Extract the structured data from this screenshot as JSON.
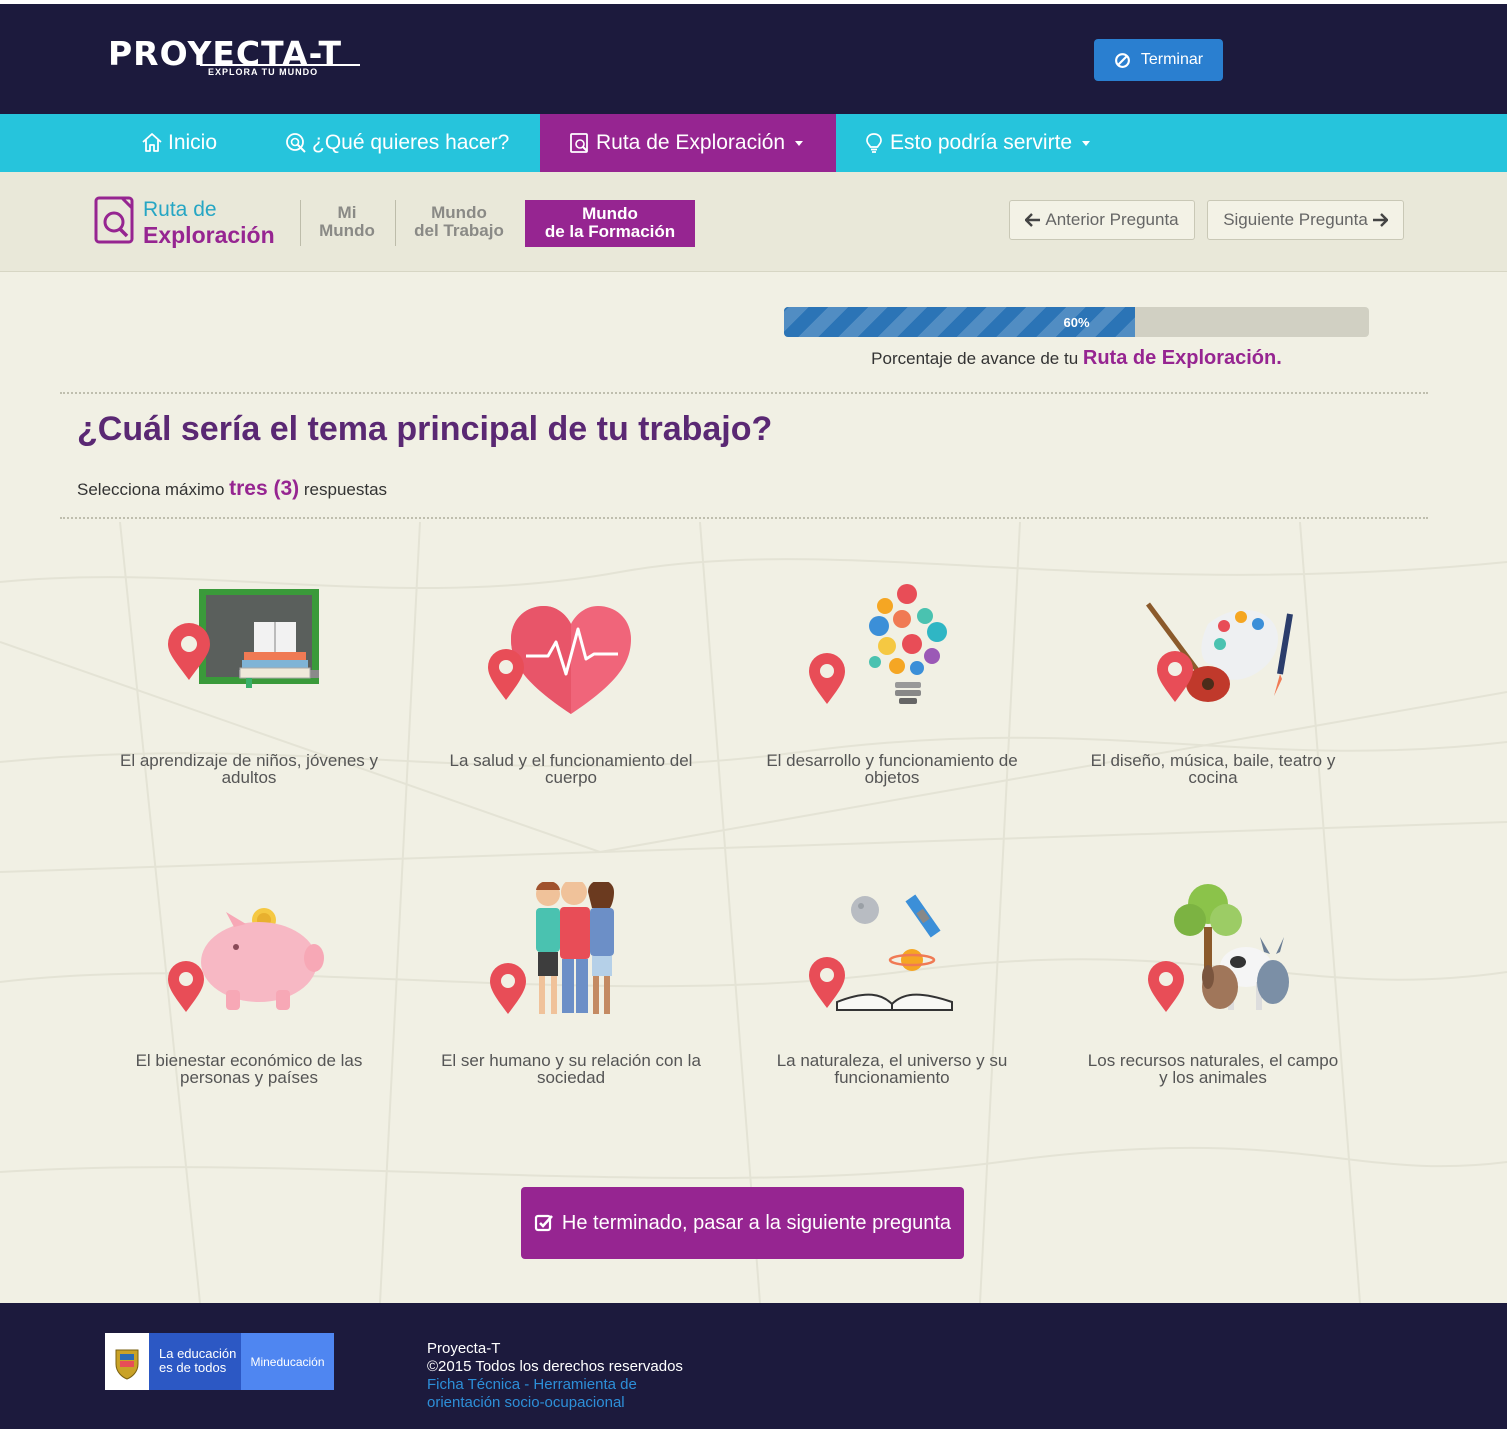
{
  "header": {
    "logo_main": "PROYECTA-T",
    "logo_sub": "EXPLORA TU MUNDO",
    "terminar_label": "Terminar"
  },
  "nav": {
    "items": [
      {
        "label": "Inicio",
        "icon": "home-icon"
      },
      {
        "label": "¿Qué quieres hacer?",
        "icon": "search-icon"
      },
      {
        "label": "Ruta de Exploración",
        "icon": "route-document-icon",
        "active": true
      },
      {
        "label": "Esto podría servirte",
        "icon": "lightbulb-icon"
      }
    ]
  },
  "subnav": {
    "ruta_line1": "Ruta de",
    "ruta_line2": "Exploración",
    "steps": [
      {
        "line1": "Mi",
        "line2": "Mundo"
      },
      {
        "line1": "Mundo",
        "line2": "del Trabajo"
      },
      {
        "line1": "Mundo",
        "line2": "de la Formación",
        "active": true
      }
    ],
    "prev_label": "Anterior Pregunta",
    "next_label": "Siguiente Pregunta"
  },
  "progress": {
    "value": 60,
    "label": "60%",
    "caption_prefix": "Porcentaje de avance de tu ",
    "caption_highlight": "Ruta de Exploración."
  },
  "question": {
    "title": "¿Cuál sería el tema principal de tu trabajo?",
    "instruction_prefix": "Selecciona máximo ",
    "instruction_highlight": "tres (3)",
    "instruction_suffix": " respuestas"
  },
  "options": [
    {
      "line1": "El aprendizaje de niños, jóvenes y",
      "line2": "adultos",
      "icon": "chalkboard-books-icon"
    },
    {
      "line1": "La salud y el funcionamiento del",
      "line2": "cuerpo",
      "icon": "heart-pulse-icon"
    },
    {
      "line1": "El desarrollo y funcionamiento de",
      "line2": "objetos",
      "icon": "gears-lightbulb-icon"
    },
    {
      "line1": "El diseño, música, baile, teatro y",
      "line2": "cocina",
      "icon": "guitar-palette-icon"
    },
    {
      "line1": "El bienestar económico de las",
      "line2": "personas y países",
      "icon": "piggy-bank-icon"
    },
    {
      "line1": "El ser humano y su relación con la",
      "line2": "sociedad",
      "icon": "people-group-icon"
    },
    {
      "line1": "La naturaleza, el universo y su",
      "line2": "funcionamiento",
      "icon": "book-universe-icon"
    },
    {
      "line1": "Los recursos naturales, el campo",
      "line2": "y los animales",
      "icon": "tree-animals-icon"
    }
  ],
  "finish_label": "He terminado, pasar a la siguiente pregunta",
  "footer": {
    "edu_line1": "La educación",
    "edu_line2": "es de todos",
    "min_label": "Mineducación",
    "line1": "Proyecta-T",
    "line2": "©2015 Todos los derechos reservados",
    "link_line1": "Ficha Técnica - Herramienta de",
    "link_line2": "orientación socio-ocupacional"
  },
  "colors": {
    "header_bg": "#1c1a3d",
    "nav_bg": "#26c4dc",
    "accent_purple": "#962591",
    "progress_blue": "#2b74b6",
    "button_blue": "#2a7fd0",
    "content_bg": "#f1f0e4"
  }
}
